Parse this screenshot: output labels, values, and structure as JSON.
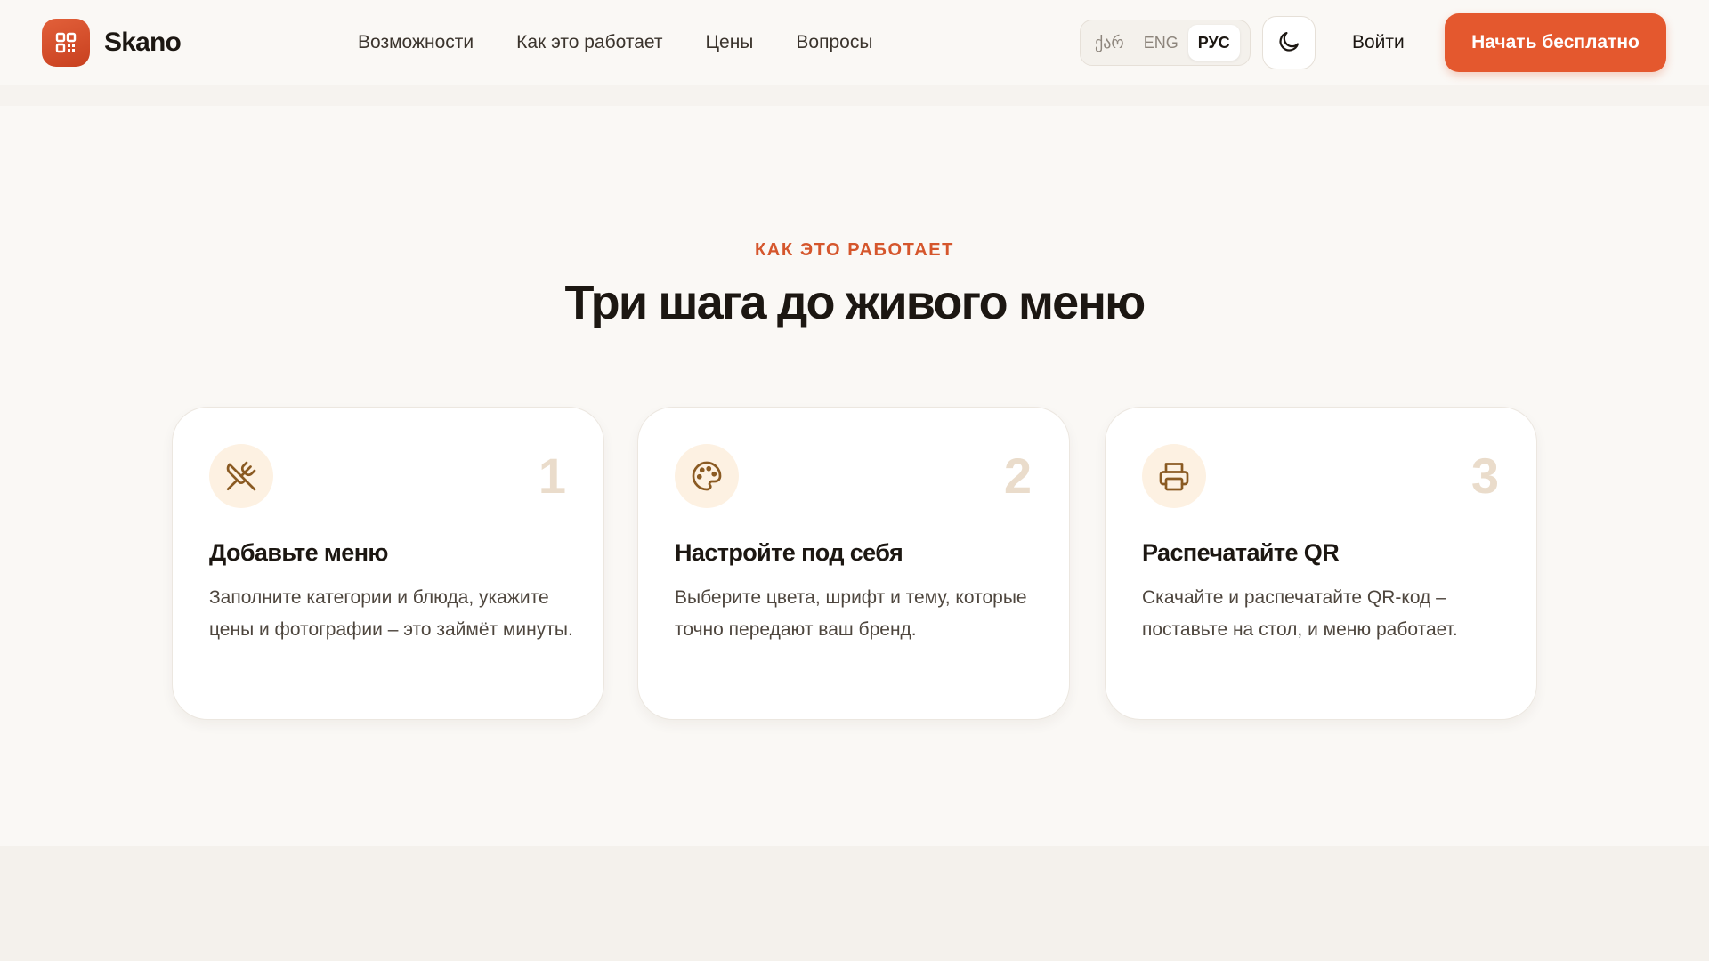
{
  "brand": {
    "name": "Skano",
    "accent": "#e4582e",
    "logo_icon": "grid-icon"
  },
  "nav": {
    "items": [
      {
        "label": "Возможности"
      },
      {
        "label": "Как это работает"
      },
      {
        "label": "Цены"
      },
      {
        "label": "Вопросы"
      }
    ]
  },
  "languages": {
    "options": [
      "ქარ",
      "ENG",
      "РУС"
    ],
    "selected": "РУС"
  },
  "theme_toggle": {
    "icon": "moon-icon"
  },
  "header_actions": {
    "login": "Войти",
    "cta": "Начать бесплатно"
  },
  "section": {
    "eyebrow": "КАК ЭТО РАБОТАЕТ",
    "title": "Три шага до живого меню",
    "steps": [
      {
        "number": "1",
        "icon": "utensils-crossed-icon",
        "title": "Добавьте меню",
        "text": "Заполните категории и блюда, укажите цены и фотографии – это займёт минуты."
      },
      {
        "number": "2",
        "icon": "palette-icon",
        "title": "Настройте под себя",
        "text": "Выберите цвета, шрифт и тему, которые точно передают ваш бренд."
      },
      {
        "number": "3",
        "icon": "printer-icon",
        "title": "Распечатайте QR",
        "text": "Скачайте и распечатайте QR-код – поставьте на стол, и меню работает."
      }
    ]
  }
}
